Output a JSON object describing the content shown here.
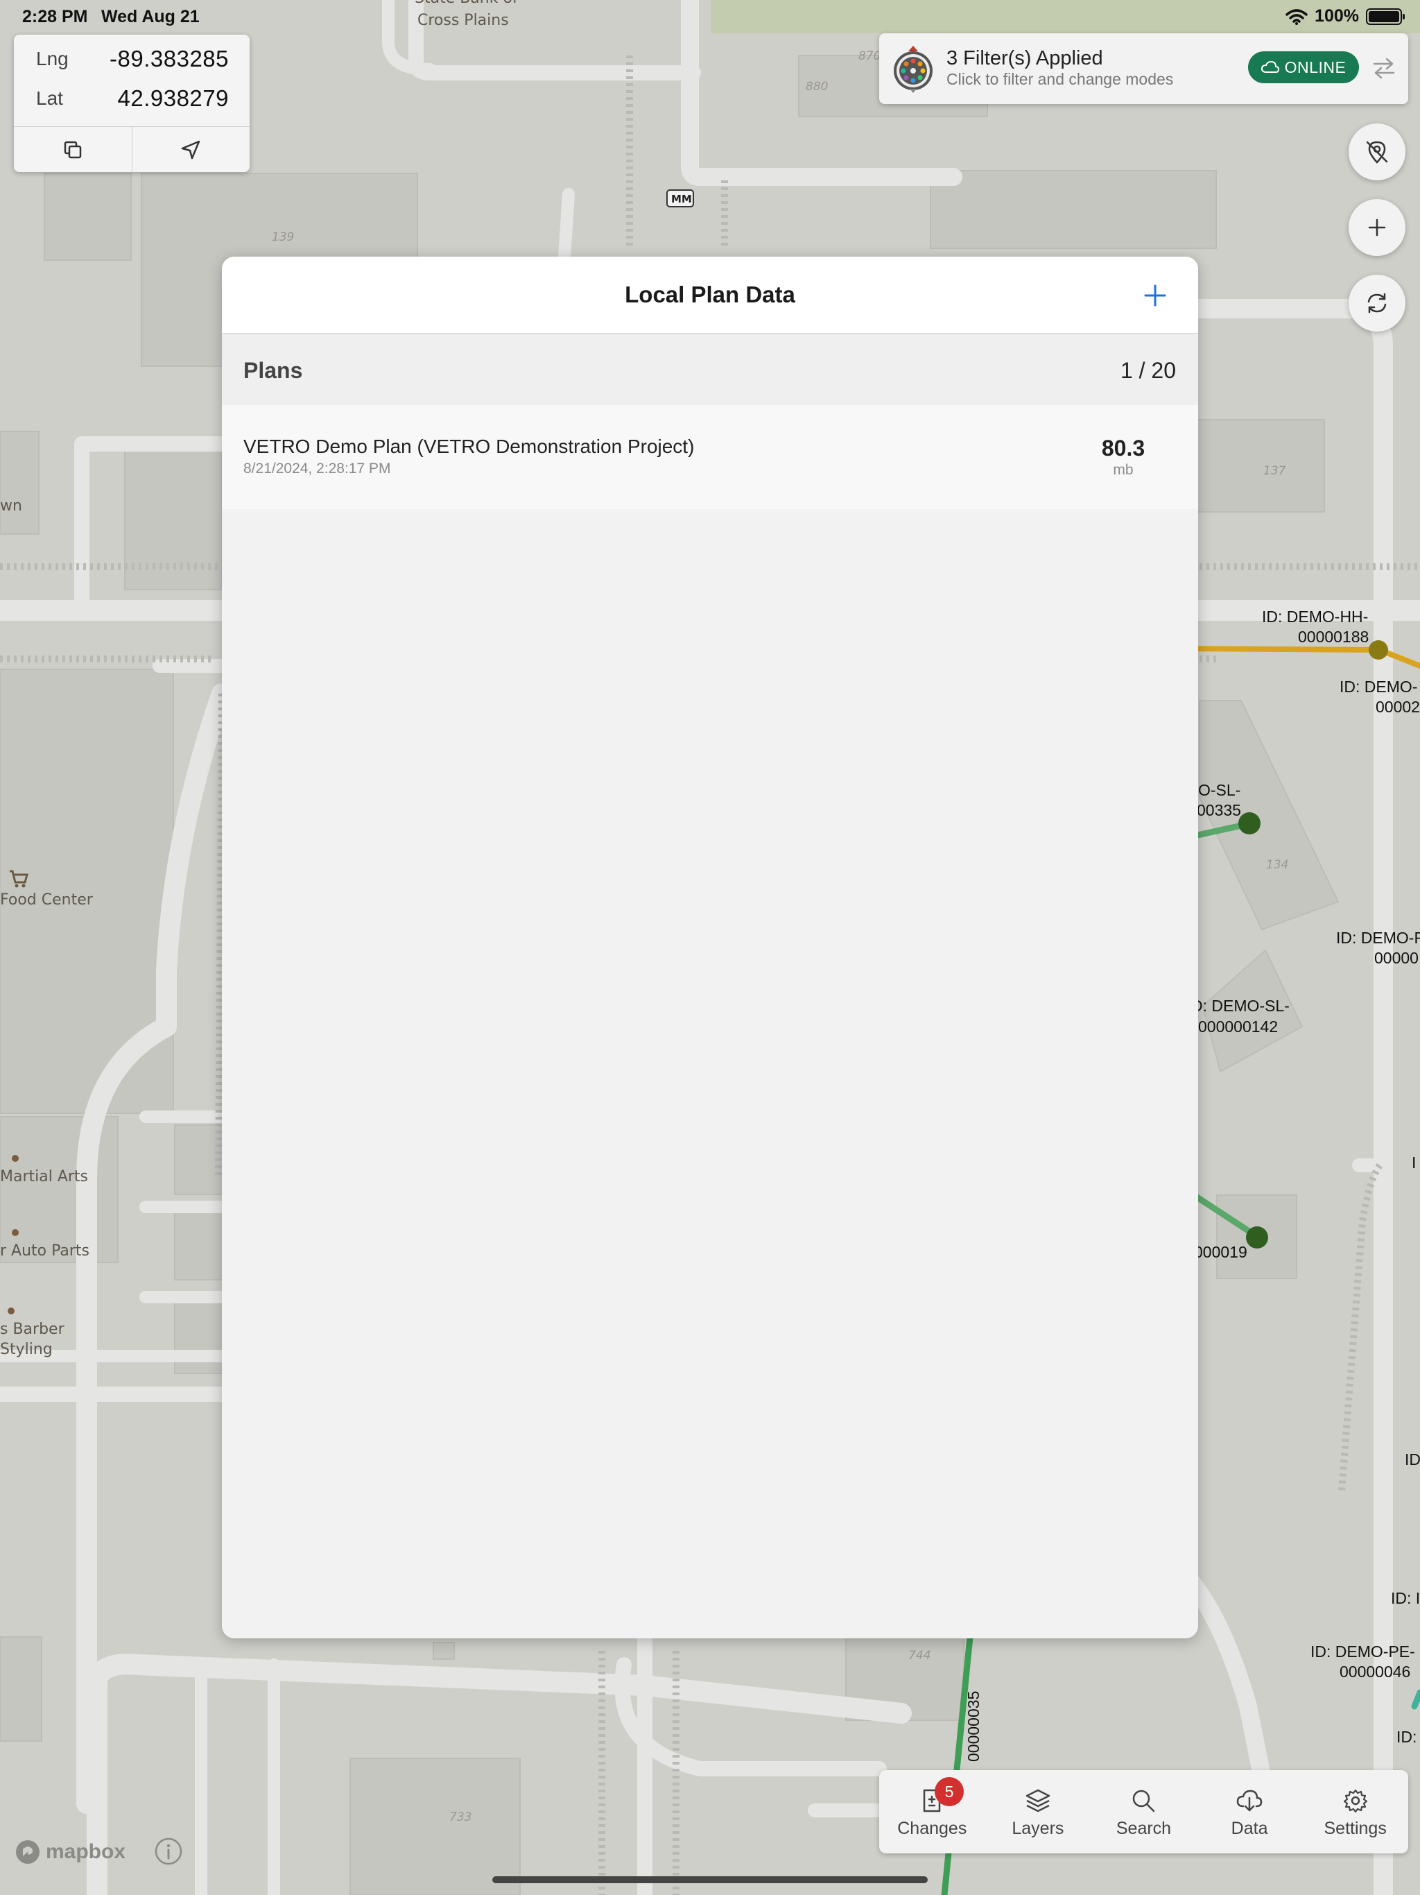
{
  "status_bar": {
    "time": "2:28 PM",
    "date": "Wed Aug 21",
    "battery": "100%"
  },
  "coordinates": {
    "lng_label": "Lng",
    "lng_value": "-89.383285",
    "lat_label": "Lat",
    "lat_value": "42.938279",
    "copy_icon": "copy-icon",
    "locate_icon": "navigation-arrow-icon"
  },
  "filter_bar": {
    "title": "3 Filter(s) Applied",
    "subtitle": "Click to filter and change modes",
    "status": "ONLINE",
    "status_color": "#177a52"
  },
  "modal": {
    "title": "Local Plan Data",
    "add_icon": "plus-icon",
    "accent_color": "#1a73e8",
    "section_title": "Plans",
    "count": "1 / 20",
    "plans": [
      {
        "name": "VETRO Demo Plan (VETRO Demonstration Project)",
        "date": "8/21/2024, 2:28:17 PM",
        "size": "80.3",
        "unit": "mb"
      }
    ]
  },
  "tabbar": {
    "tabs": [
      {
        "label": "Changes",
        "icon": "changes-icon",
        "badge": "5"
      },
      {
        "label": "Layers",
        "icon": "layers-icon"
      },
      {
        "label": "Search",
        "icon": "search-icon"
      },
      {
        "label": "Data",
        "icon": "data-download-icon"
      },
      {
        "label": "Settings",
        "icon": "gear-icon"
      }
    ]
  },
  "map": {
    "labels": {
      "bank_line1": "State Bank of",
      "bank_line2": "Cross Plains",
      "mm": "MM",
      "town": "wn",
      "food": "Food Center",
      "martial": "Martial Arts",
      "auto": "r Auto Parts",
      "barber_line1": "s Barber",
      "barber_line2": "Styling"
    },
    "building_numbers": {
      "b880": "880",
      "b139": "139",
      "b137": "137",
      "b134": "134",
      "b744": "744",
      "b733": "733",
      "b870": "870"
    },
    "feature_labels": {
      "hh_line1": "ID: DEMO-HH-",
      "hh_line2": "00000188",
      "demo_a_line1": "ID: DEMO-",
      "demo_a_line2": "00002",
      "sl335_line1": "O-SL-",
      "sl335_line2": "00335",
      "demo_b_line1": "ID: DEMO-F",
      "demo_b_line2": "00000",
      "sl142_line1": "D: DEMO-SL-",
      "sl142_line2": "000000142",
      "id19": "000019",
      "pe_line1": "ID: DEMO-PE-",
      "pe_line2": "00000046",
      "cable35": "00000035",
      "edge_1": "I",
      "edge_2": "ID",
      "edge_3": "ID: I",
      "edge_4": "ID:"
    },
    "attribution": "mapbox"
  }
}
